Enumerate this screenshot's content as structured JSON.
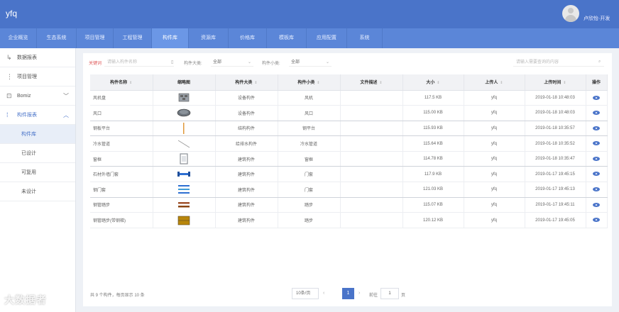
{
  "header": {
    "title": "yfq",
    "user_name": "卢欣怡·开发"
  },
  "nav": [
    {
      "label": "企业概览",
      "width": 52
    },
    {
      "label": "生态系统",
      "width": 56
    },
    {
      "label": "项目管理",
      "width": 52
    },
    {
      "label": "工程管理",
      "width": 54
    },
    {
      "label": "构件库",
      "width": 52
    },
    {
      "label": "资源库",
      "width": 56
    },
    {
      "label": "价格库",
      "width": 54
    },
    {
      "label": "模板库",
      "width": 56
    },
    {
      "label": "应用配置",
      "width": 57
    },
    {
      "label": "系统",
      "width": 50
    }
  ],
  "sidebar": {
    "items": [
      {
        "label": "数据报表",
        "icon": "chart-icon"
      },
      {
        "label": "项目管理",
        "icon": "folder-icon"
      },
      {
        "label": "Bomiz",
        "icon": "cube-icon",
        "chevron": "﹀"
      },
      {
        "label": "构件报表",
        "icon": "component-icon",
        "chevron": "︿"
      }
    ],
    "subitems": [
      {
        "label": "构件库"
      },
      {
        "label": "已设计"
      },
      {
        "label": "可复用"
      },
      {
        "label": "未设计"
      }
    ]
  },
  "filters": {
    "keyword_label": "关键词",
    "keyword_placeholder": "请输入构件名称",
    "type_label": "构件大类:",
    "type_value": "全部",
    "sub_label": "构件小类:",
    "sub_value": "全部",
    "search_placeholder": "请输入需要查询的内容"
  },
  "table": {
    "columns": [
      "构件名称",
      "缩略图",
      "构件大类",
      "构件小类",
      "文件描述",
      "大小",
      "上传人",
      "上传时间",
      "操作"
    ],
    "rows": [
      {
        "name": "风机盘",
        "thumb": "block",
        "category": "设备构件",
        "subcategory": "风机",
        "desc": "",
        "size": "117.5 KB",
        "uploader": "yfq",
        "time": "2019-01-18 10:48:03",
        "group_end": false
      },
      {
        "name": "风口",
        "thumb": "disc",
        "category": "设备构件",
        "subcategory": "风口",
        "desc": "",
        "size": "115.00 KB",
        "uploader": "yfq",
        "time": "2019-01-18 10:48:03",
        "group_end": true
      },
      {
        "name": "钢板平台",
        "thumb": "thin-bar",
        "category": "结构构件",
        "subcategory": "钢平台",
        "desc": "",
        "size": "115.93 KB",
        "uploader": "yfq",
        "time": "2019-01-18 10:35:57",
        "group_end": true
      },
      {
        "name": "冷水管道",
        "thumb": "diagonal",
        "category": "给排水构件",
        "subcategory": "冷水管道",
        "desc": "",
        "size": "115.64 KB",
        "uploader": "yfq",
        "time": "2019-01-18 10:35:52",
        "group_end": false
      },
      {
        "name": "窗框",
        "thumb": "frame",
        "category": "建筑构件",
        "subcategory": "窗框",
        "desc": "",
        "size": "114.78 KB",
        "uploader": "yfq",
        "time": "2019-01-18 10:35:47",
        "group_end": true
      },
      {
        "name": "石材外墙门套",
        "thumb": "blue-bar",
        "category": "建筑构件",
        "subcategory": "门套",
        "desc": "",
        "size": "117.9 KB",
        "uploader": "yfq",
        "time": "2019-01-17 19:45:15",
        "group_end": false
      },
      {
        "name": "钢门套",
        "thumb": "stripes",
        "category": "建筑构件",
        "subcategory": "门套",
        "desc": "",
        "size": "121.03 KB",
        "uploader": "yfq",
        "time": "2019-01-17 19:45:13",
        "group_end": true
      },
      {
        "name": "钢管踏步",
        "thumb": "brown-bar",
        "category": "建筑构件",
        "subcategory": "踏步",
        "desc": "",
        "size": "115.07 KB",
        "uploader": "yfq",
        "time": "2019-01-17 19:45:11",
        "group_end": false
      },
      {
        "name": "钢管踏步(带钢梯)",
        "thumb": "panel",
        "category": "建筑构件",
        "subcategory": "踏步",
        "desc": "",
        "size": "120.12 KB",
        "uploader": "yfq",
        "time": "2019-01-17 19:45:05",
        "group_end": false
      }
    ]
  },
  "pagination": {
    "total_text": "共 9 个构件，每页显示 10 条",
    "page_size": "10条/页",
    "current_page": "1",
    "prev": "‹",
    "next": "›",
    "goto_prefix": "前往",
    "goto_value": "1",
    "goto_suffix": "页"
  },
  "watermark": "大数据者",
  "colors": {
    "header": "#4a74c9",
    "nav": "#5b86d8",
    "accent": "#4a74c9"
  }
}
